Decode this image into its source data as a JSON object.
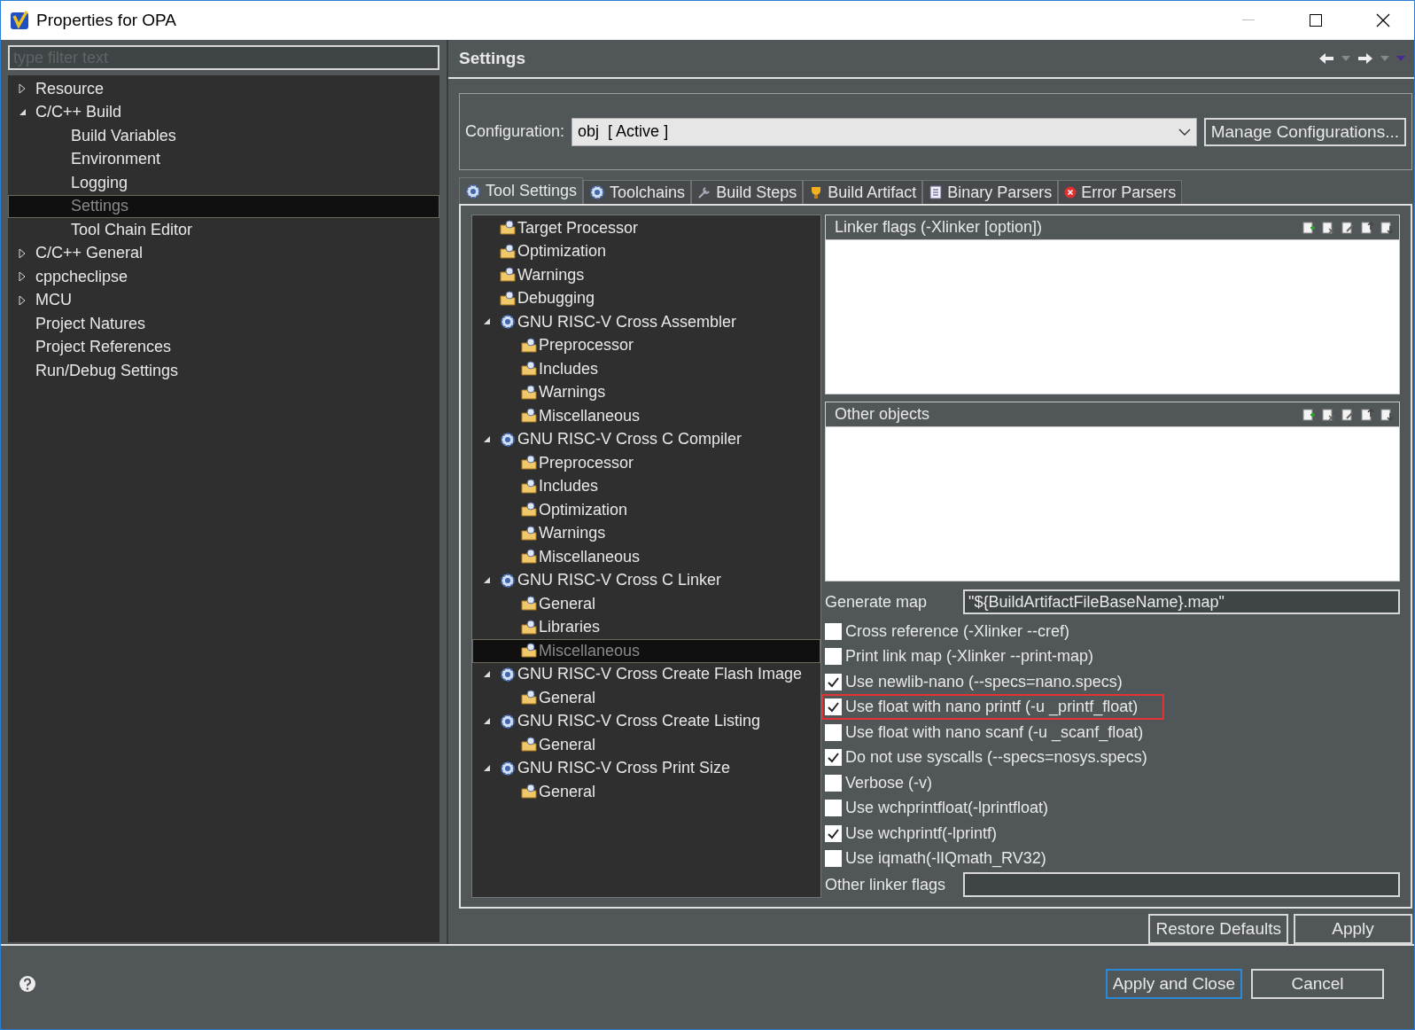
{
  "window": {
    "title": "Properties for OPA"
  },
  "filter": {
    "placeholder": "type filter text"
  },
  "nav_tree": [
    {
      "label": "Resource",
      "expanded": false,
      "selected": false
    },
    {
      "label": "C/C++ Build",
      "expanded": true,
      "selected": false,
      "children": [
        {
          "label": "Build Variables",
          "selected": false
        },
        {
          "label": "Environment",
          "selected": false
        },
        {
          "label": "Logging",
          "selected": false
        },
        {
          "label": "Settings",
          "selected": true
        },
        {
          "label": "Tool Chain Editor",
          "selected": false
        }
      ]
    },
    {
      "label": "C/C++ General",
      "expanded": false,
      "selected": false
    },
    {
      "label": "cppcheclipse",
      "expanded": false,
      "selected": false
    },
    {
      "label": "MCU",
      "expanded": false,
      "selected": false
    },
    {
      "label": "Project Natures",
      "selected": false
    },
    {
      "label": "Project References",
      "selected": false
    },
    {
      "label": "Run/Debug Settings",
      "selected": false
    }
  ],
  "page": {
    "title": "Settings"
  },
  "configuration": {
    "label": "Configuration:",
    "value": "obj  [ Active ]",
    "button": "Manage Configurations..."
  },
  "tabs": [
    {
      "label": "Tool Settings",
      "kind": "settings",
      "selected": true
    },
    {
      "label": "Toolchains",
      "kind": "settings",
      "selected": false
    },
    {
      "label": "Build Steps",
      "kind": "steps",
      "selected": false
    },
    {
      "label": "Build Artifact",
      "kind": "artifact",
      "selected": false
    },
    {
      "label": "Binary Parsers",
      "kind": "parsers",
      "selected": false
    },
    {
      "label": "Error Parsers",
      "kind": "errors",
      "selected": false
    }
  ],
  "tool_tree": [
    {
      "label": "Target Processor",
      "kind": "folder",
      "selected": false
    },
    {
      "label": "Optimization",
      "kind": "folder",
      "selected": false
    },
    {
      "label": "Warnings",
      "kind": "folder",
      "selected": false
    },
    {
      "label": "Debugging",
      "kind": "folder",
      "selected": false
    },
    {
      "label": "GNU RISC-V Cross Assembler",
      "kind": "tool",
      "expanded": true,
      "selected": false,
      "children": [
        {
          "label": "Preprocessor",
          "kind": "folder",
          "selected": false
        },
        {
          "label": "Includes",
          "kind": "folder",
          "selected": false
        },
        {
          "label": "Warnings",
          "kind": "folder",
          "selected": false
        },
        {
          "label": "Miscellaneous",
          "kind": "folder",
          "selected": false
        }
      ]
    },
    {
      "label": "GNU RISC-V Cross C Compiler",
      "kind": "tool",
      "expanded": true,
      "selected": false,
      "children": [
        {
          "label": "Preprocessor",
          "kind": "folder",
          "selected": false
        },
        {
          "label": "Includes",
          "kind": "folder",
          "selected": false
        },
        {
          "label": "Optimization",
          "kind": "folder",
          "selected": false
        },
        {
          "label": "Warnings",
          "kind": "folder",
          "selected": false
        },
        {
          "label": "Miscellaneous",
          "kind": "folder",
          "selected": false
        }
      ]
    },
    {
      "label": "GNU RISC-V Cross C Linker",
      "kind": "tool",
      "expanded": true,
      "selected": false,
      "children": [
        {
          "label": "General",
          "kind": "folder",
          "selected": false
        },
        {
          "label": "Libraries",
          "kind": "folder",
          "selected": false
        },
        {
          "label": "Miscellaneous",
          "kind": "folder",
          "selected": true
        }
      ]
    },
    {
      "label": "GNU RISC-V Cross Create Flash Image",
      "kind": "tool",
      "expanded": true,
      "selected": false,
      "children": [
        {
          "label": "General",
          "kind": "folder",
          "selected": false
        }
      ]
    },
    {
      "label": "GNU RISC-V Cross Create Listing",
      "kind": "tool",
      "expanded": true,
      "selected": false,
      "children": [
        {
          "label": "General",
          "kind": "folder",
          "selected": false
        }
      ]
    },
    {
      "label": "GNU RISC-V Cross Print Size",
      "kind": "tool",
      "expanded": true,
      "selected": false,
      "children": [
        {
          "label": "General",
          "kind": "folder",
          "selected": false
        }
      ]
    }
  ],
  "lists": [
    {
      "title": "Linker flags (-Xlinker [option])"
    },
    {
      "title": "Other objects"
    }
  ],
  "generate_map": {
    "label": "Generate map",
    "value": "\"${BuildArtifactFileBaseName}.map\""
  },
  "options": [
    {
      "label": "Cross reference (-Xlinker --cref)",
      "checked": false,
      "highlighted": false
    },
    {
      "label": "Print link map (-Xlinker --print-map)",
      "checked": false,
      "highlighted": false
    },
    {
      "label": "Use newlib-nano (--specs=nano.specs)",
      "checked": true,
      "highlighted": false
    },
    {
      "label": "Use float with nano printf (-u _printf_float)",
      "checked": true,
      "highlighted": true
    },
    {
      "label": "Use float with nano scanf (-u _scanf_float)",
      "checked": false,
      "highlighted": false
    },
    {
      "label": "Do not use syscalls (--specs=nosys.specs)",
      "checked": true,
      "highlighted": false
    },
    {
      "label": "Verbose (-v)",
      "checked": false,
      "highlighted": false
    },
    {
      "label": "Use wchprintfloat(-lprintfloat)",
      "checked": false,
      "highlighted": false
    },
    {
      "label": "Use wchprintf(-lprintf)",
      "checked": true,
      "highlighted": false
    },
    {
      "label": "Use iqmath(-lIQmath_RV32)",
      "checked": false,
      "highlighted": false
    }
  ],
  "other_flags": {
    "label": "Other linker flags"
  },
  "page_buttons": [
    "Restore Defaults",
    "Apply"
  ],
  "dialog_buttons": [
    {
      "label": "Apply and Close",
      "selected": true
    },
    {
      "label": "Cancel",
      "selected": false
    }
  ]
}
